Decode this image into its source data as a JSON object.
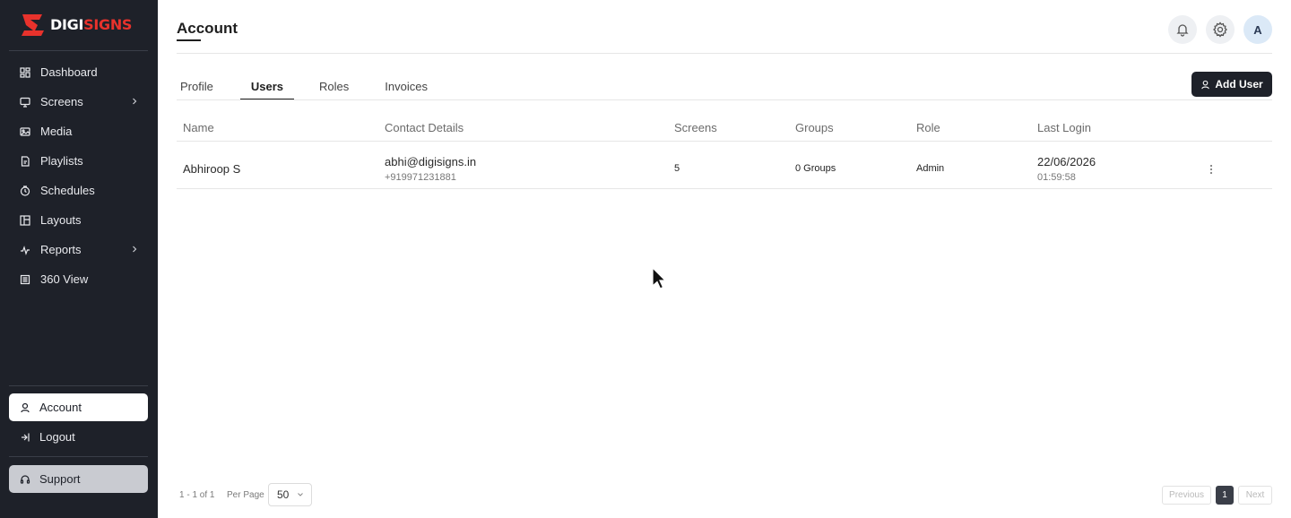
{
  "brand": {
    "prefix": "DIGI",
    "suffix": "SIGNS"
  },
  "sidebar": {
    "items": [
      {
        "label": "Dashboard",
        "icon": "dashboard-icon"
      },
      {
        "label": "Screens",
        "icon": "monitor-icon",
        "has_submenu": true
      },
      {
        "label": "Media",
        "icon": "media-icon"
      },
      {
        "label": "Playlists",
        "icon": "playlist-icon"
      },
      {
        "label": "Schedules",
        "icon": "clock-icon"
      },
      {
        "label": "Layouts",
        "icon": "layout-icon"
      },
      {
        "label": "Reports",
        "icon": "activity-icon",
        "has_submenu": true
      },
      {
        "label": "360 View",
        "icon": "list-icon"
      }
    ],
    "account": "Account",
    "logout": "Logout",
    "support": "Support"
  },
  "header": {
    "title": "Account",
    "avatar_initial": "A"
  },
  "tabs": [
    {
      "label": "Profile",
      "active": false
    },
    {
      "label": "Users",
      "active": true
    },
    {
      "label": "Roles",
      "active": false
    },
    {
      "label": "Invoices",
      "active": false
    }
  ],
  "add_user_label": "Add User",
  "table": {
    "columns": [
      "Name",
      "Contact Details",
      "Screens",
      "Groups",
      "Role",
      "Last Login"
    ],
    "rows": [
      {
        "name": "Abhiroop S",
        "email": "abhi@digisigns.in",
        "phone": "+919971231881",
        "screens": "5",
        "groups": "0 Groups",
        "role": "Admin",
        "last_login_date": "22/06/2026",
        "last_login_time": "01:59:58"
      }
    ]
  },
  "footer": {
    "range": "1 - 1 of 1",
    "per_page_label": "Per Page",
    "per_page_value": "50",
    "previous": "Previous",
    "current_page": "1",
    "next": "Next"
  },
  "colors": {
    "sidebar_bg": "#1e2129",
    "brand_red": "#e8322c",
    "primary_button": "#1e2129"
  }
}
